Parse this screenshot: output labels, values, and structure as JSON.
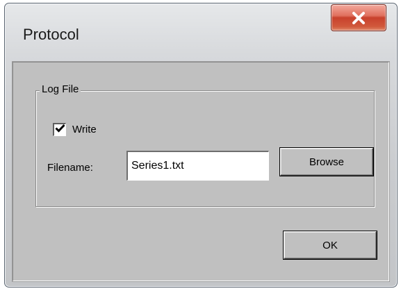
{
  "window": {
    "title": "Protocol",
    "close_icon": "close-x-icon"
  },
  "log_file_group": {
    "label": "Log File",
    "write_checkbox": {
      "label": "Write",
      "checked": true
    },
    "filename": {
      "label": "Filename:",
      "value": "Series1.txt"
    },
    "browse_label": "Browse"
  },
  "ok_label": "OK",
  "colors": {
    "close_button": "#c8412c",
    "dialog_face": "#c0c0c0"
  }
}
